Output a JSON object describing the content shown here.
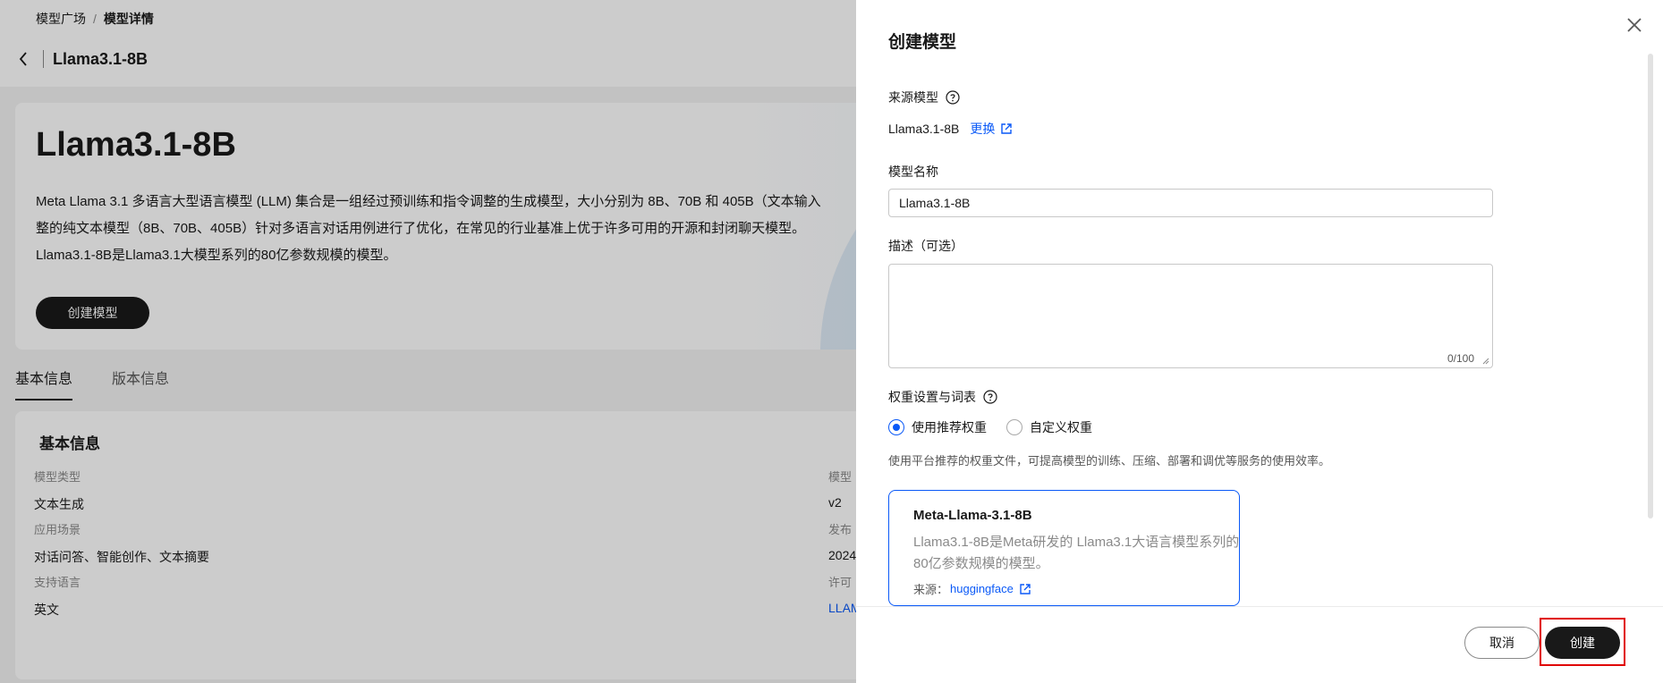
{
  "breadcrumb": {
    "root": "模型广场",
    "separator": "/",
    "current": "模型详情"
  },
  "header": {
    "title": "Llama3.1-8B"
  },
  "hero": {
    "model_name": "Llama3.1-8B",
    "desc_line1": "Meta Llama 3.1 多语言大型语言模型 (LLM) 集合是一组经过预训练和指令调整的生成模型，大小分别为 8B、70B 和 405B（文本输入",
    "desc_line2": "整的纯文本模型（8B、70B、405B）针对多语言对话用例进行了优化，在常见的行业基准上优于许多可用的开源和封闭聊天模型。",
    "desc_line3": "Llama3.1-8B是Llama3.1大模型系列的80亿参数规模的模型。",
    "create_button": "创建模型"
  },
  "tabs": [
    {
      "label": "基本信息"
    },
    {
      "label": "版本信息"
    }
  ],
  "info": {
    "title": "基本信息",
    "fields": [
      {
        "label": "模型类型",
        "value": "文本生成"
      },
      {
        "label": "应用场景",
        "value": "对话问答、智能创作、文本摘要"
      },
      {
        "label": "支持语言",
        "value": "英文"
      },
      {
        "label": "模型",
        "value": "v2"
      },
      {
        "label": "发布",
        "value": "2024"
      },
      {
        "label": "许可",
        "value": "LLAM"
      }
    ]
  },
  "drawer": {
    "title": "创建模型",
    "source_label": "来源模型",
    "source_value": "Llama3.1-8B",
    "change_link": "更换",
    "name_label": "模型名称",
    "name_value": "Llama3.1-8B",
    "desc_label": "描述（可选）",
    "desc_value": "",
    "desc_counter": "0/100",
    "weight_label": "权重设置与词表",
    "radio_recommended": "使用推荐权重",
    "radio_custom": "自定义权重",
    "hint": "使用平台推荐的权重文件，可提高模型的训练、压缩、部署和调优等服务的使用效率。",
    "weight_card": {
      "title": "Meta-Llama-3.1-8B",
      "desc": "Llama3.1-8B是Meta研发的 Llama3.1大语言模型系列的80亿参数规模的模型。",
      "source_prefix": "来源：",
      "source_link": "huggingface"
    },
    "cancel": "取消",
    "create": "创建"
  },
  "colors": {
    "accent": "#0a59f7",
    "primary_button": "#191919",
    "highlight": "#e00000"
  }
}
